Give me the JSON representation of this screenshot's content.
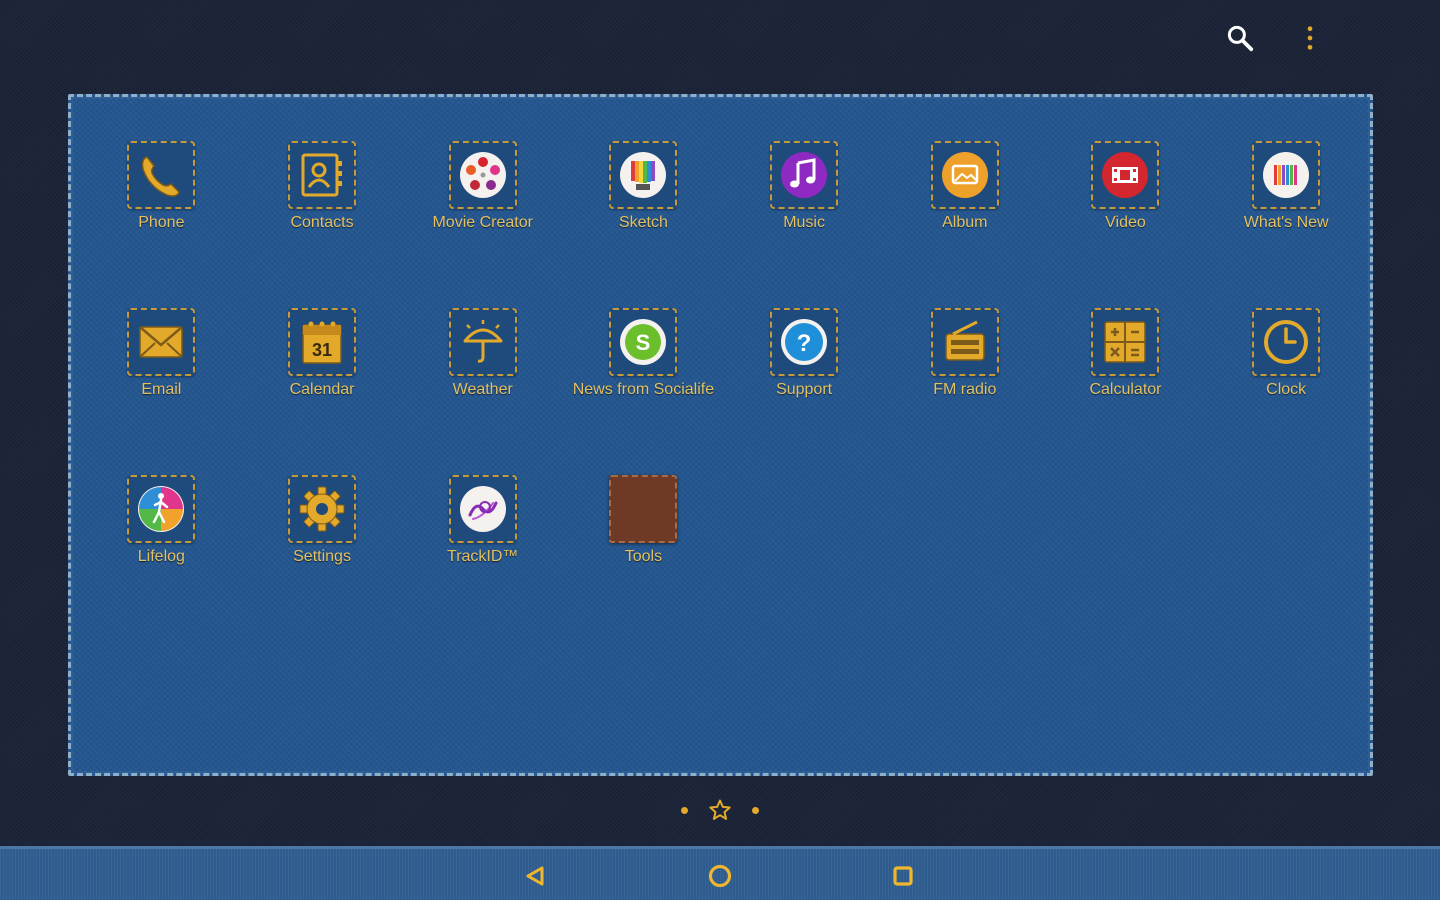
{
  "accent_color": "#e3a92b",
  "label_color": "#e3c062",
  "top_actions": [
    {
      "name": "search-button",
      "icon": "search-icon"
    },
    {
      "name": "overflow-menu-button",
      "icon": "more-vert-icon"
    }
  ],
  "apps": [
    {
      "label": "Phone",
      "icon": "phone-icon"
    },
    {
      "label": "Contacts",
      "icon": "contacts-icon"
    },
    {
      "label": "Movie Creator",
      "icon": "movie-creator-icon"
    },
    {
      "label": "Sketch",
      "icon": "sketch-icon"
    },
    {
      "label": "Music",
      "icon": "music-icon"
    },
    {
      "label": "Album",
      "icon": "album-icon"
    },
    {
      "label": "Video",
      "icon": "video-icon"
    },
    {
      "label": "What's New",
      "icon": "whats-new-icon"
    },
    {
      "label": "Email",
      "icon": "email-icon"
    },
    {
      "label": "Calendar",
      "icon": "calendar-icon",
      "icon_text": "31"
    },
    {
      "label": "Weather",
      "icon": "weather-icon"
    },
    {
      "label": "News from Socialife",
      "icon": "socialife-icon",
      "icon_text": "S"
    },
    {
      "label": "Support",
      "icon": "support-icon",
      "icon_text": "?"
    },
    {
      "label": "FM radio",
      "icon": "fm-radio-icon"
    },
    {
      "label": "Calculator",
      "icon": "calculator-icon"
    },
    {
      "label": "Clock",
      "icon": "clock-icon"
    },
    {
      "label": "Lifelog",
      "icon": "lifelog-icon"
    },
    {
      "label": "Settings",
      "icon": "gear-icon"
    },
    {
      "label": "TrackID™",
      "icon": "trackid-icon"
    },
    {
      "label": "Tools",
      "icon": "folder-icon"
    }
  ],
  "page_indicator": {
    "pages": 3,
    "current_page_icon": "star-icon"
  },
  "navigation_bar": [
    {
      "name": "back-button",
      "icon": "back-triangle-icon"
    },
    {
      "name": "home-button",
      "icon": "home-circle-icon"
    },
    {
      "name": "recents-button",
      "icon": "recents-square-icon"
    }
  ]
}
